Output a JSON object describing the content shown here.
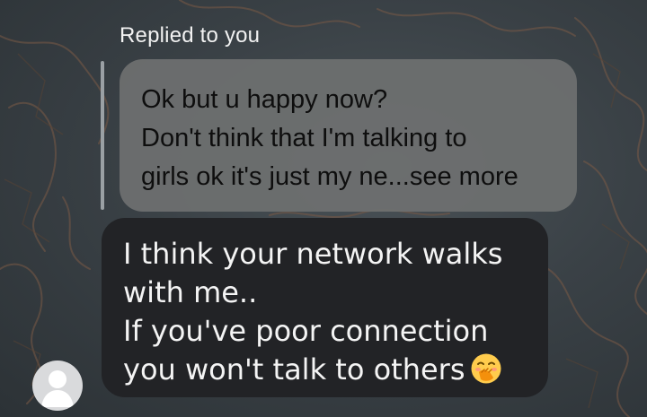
{
  "reply": {
    "label": "Replied to you",
    "quoted_lines": [
      "Ok but u happy now?",
      "Don't think that I'm talking to",
      "girls ok it's just my ne..."
    ],
    "see_more": "see more"
  },
  "message": {
    "lines": [
      "I think your network walks",
      "with me..",
      "If you've poor connection",
      "you won't talk to others"
    ],
    "emoji_icon": "hand-over-mouth-emoji-icon"
  },
  "avatar": {
    "icon": "default-user-avatar-icon"
  },
  "colors": {
    "quoted_bubble": "#6e7070",
    "message_bubble": "#222326",
    "quote_bar": "#9aa0a4"
  }
}
